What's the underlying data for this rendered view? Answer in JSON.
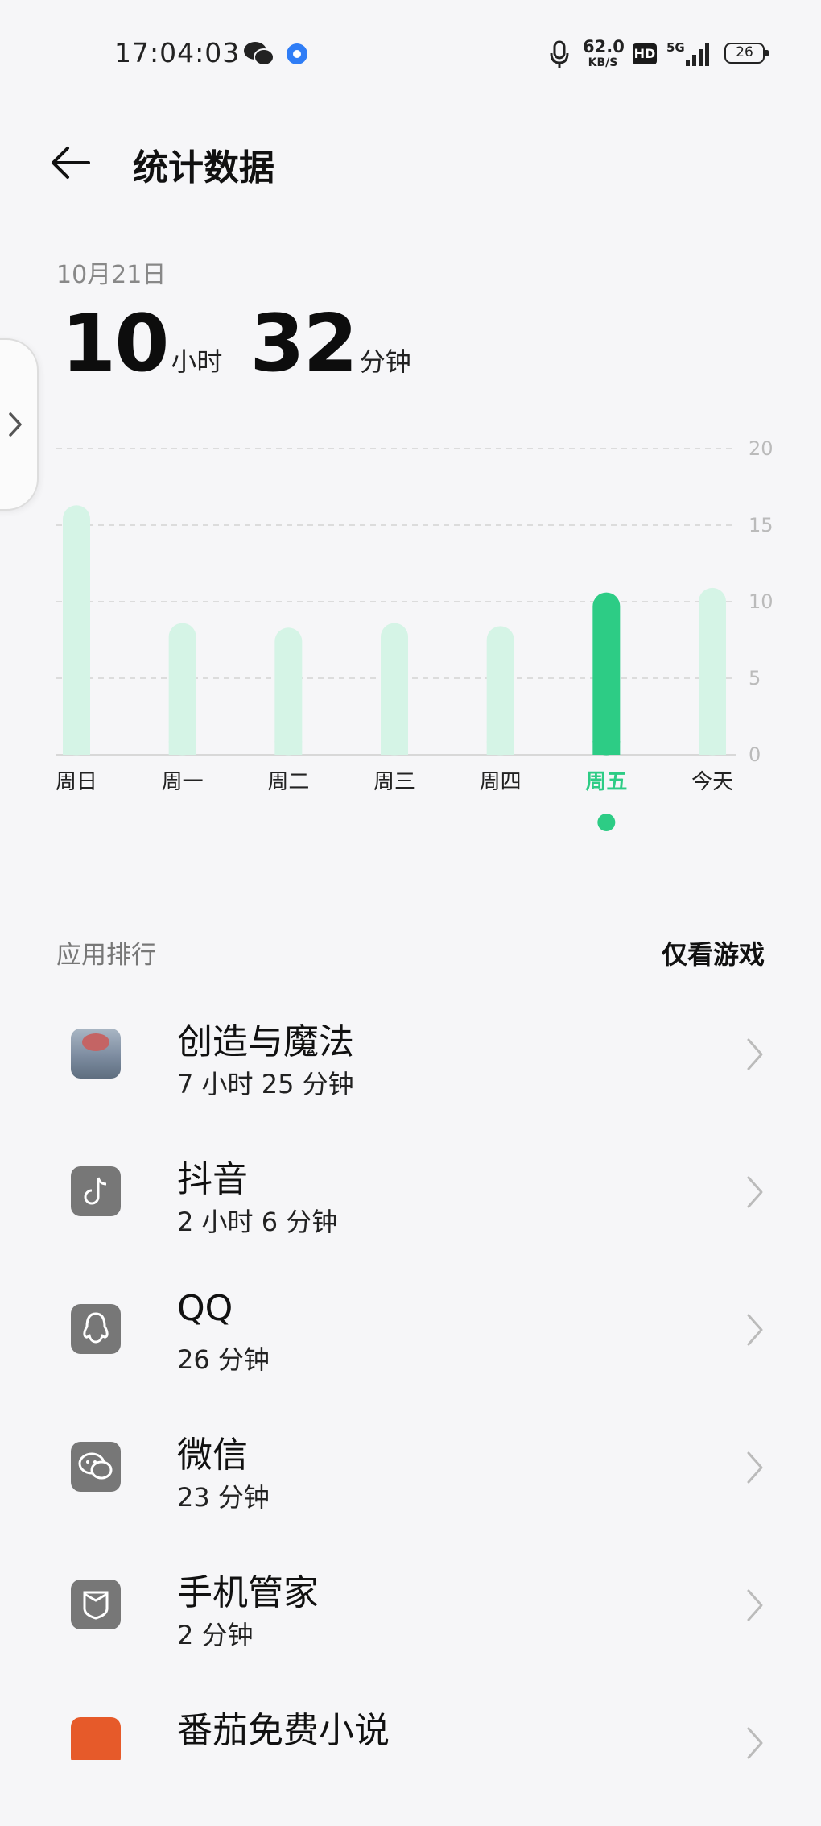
{
  "status_bar": {
    "time": "17:04:03",
    "net_speed": "62.0",
    "net_speed_unit": "KB/S",
    "hd": "HD",
    "network": "5G",
    "battery": "26"
  },
  "header": {
    "title": "统计数据"
  },
  "summary": {
    "date": "10月21日",
    "hours": "10",
    "hours_unit": "小时",
    "minutes": "32",
    "minutes_unit": "分钟"
  },
  "chart_data": {
    "type": "bar",
    "categories": [
      "周日",
      "周一",
      "周二",
      "周三",
      "周四",
      "周五",
      "今天"
    ],
    "values": [
      16.3,
      8.6,
      8.3,
      8.6,
      8.4,
      10.6,
      10.9
    ],
    "selected_index": 5,
    "ylim": [
      0,
      20
    ],
    "yticks": [
      "0",
      "5",
      "10",
      "15",
      "20"
    ],
    "grid": true,
    "colors": {
      "bar": "#d5f4e6",
      "selected_bar": "#2dcc85"
    }
  },
  "ranking": {
    "title": "应用排行",
    "filter_label": "仅看游戏",
    "apps": [
      {
        "name": "创造与魔法",
        "duration": "7 小时 25 分钟",
        "icon": "game-icon"
      },
      {
        "name": "抖音",
        "duration": "2 小时 6 分钟",
        "icon": "tiktok-icon"
      },
      {
        "name": "QQ",
        "duration": "26 分钟",
        "icon": "qq-icon"
      },
      {
        "name": "微信",
        "duration": "23 分钟",
        "icon": "wechat-icon"
      },
      {
        "name": "手机管家",
        "duration": "2 分钟",
        "icon": "phone-manager-icon"
      },
      {
        "name": "番茄免费小说",
        "duration": "",
        "icon": "novel-icon"
      }
    ]
  }
}
